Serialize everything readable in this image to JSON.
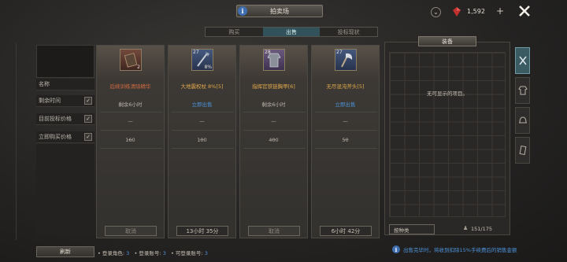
{
  "header": {
    "title": "拍卖场",
    "currency_amount": "1,592",
    "plus_label": "+",
    "info_icon": "i"
  },
  "tabs": [
    {
      "label": "购买",
      "active": false
    },
    {
      "label": "出售",
      "active": true
    },
    {
      "label": "投标现状",
      "active": false
    }
  ],
  "filters": {
    "name_label": "名称",
    "rows": [
      {
        "label": "剩余时间",
        "checked": true
      },
      {
        "label": "目前投标价格",
        "checked": true
      },
      {
        "label": "立即购买价格",
        "checked": true
      }
    ],
    "check_glyph": "✓"
  },
  "items": [
    {
      "badge_tl": "",
      "badge_br": "2",
      "name": "后续训练清除精华",
      "remaining": "剩余6小时",
      "current_bid": "—",
      "bid_extra": "—",
      "buy_now": "160",
      "button": "取消",
      "button_style": "dim",
      "name_color": "red",
      "icon": "book-icon"
    },
    {
      "badge_tl": "27",
      "badge_br": "8%",
      "name": "大地震权杖 8%[5]",
      "remaining": "立即出售",
      "current_bid": "—",
      "bid_extra": "—",
      "buy_now": "100",
      "button": "13小时 35分",
      "button_style": "normal",
      "name_color": "gold",
      "icon": "staff-icon"
    },
    {
      "badge_tl": "28",
      "badge_br": "",
      "name": "指挥官铁链胸甲[6]",
      "remaining": "剩余6小时",
      "current_bid": "—",
      "bid_extra": "—",
      "buy_now": "400",
      "button": "取消",
      "button_style": "dim",
      "name_color": "gold",
      "icon": "armor-icon"
    },
    {
      "badge_tl": "27",
      "badge_br": "",
      "name": "无尽混沌斧头[5]",
      "remaining": "立即出售",
      "current_bid": "—",
      "bid_extra": "—",
      "buy_now": "50",
      "button": "6小时 42分",
      "button_style": "normal",
      "name_color": "gold",
      "icon": "axe-icon"
    }
  ],
  "equipment": {
    "header": "装备",
    "empty_text": "无可显示的项目。",
    "sort_label": "按种类",
    "capacity": "151/175",
    "side_tabs": [
      "weapon-icon",
      "armor-icon",
      "helmet-icon",
      "scroll-icon"
    ]
  },
  "footer": {
    "refresh_label": "刷新",
    "status": [
      {
        "label": "• 登录角色:",
        "value": "3"
      },
      {
        "label": "• 登录账号:",
        "value": "3"
      },
      {
        "label": "• 可登录账号:",
        "value": "3"
      }
    ],
    "note": "出售完毕时，将收到扣除15%手续费后的销售金额"
  },
  "colors": {
    "accent_blue": "#4d93d9",
    "gold_text": "#e0a64a",
    "red_text": "#d46a3f",
    "active_tab": "#31525a"
  }
}
